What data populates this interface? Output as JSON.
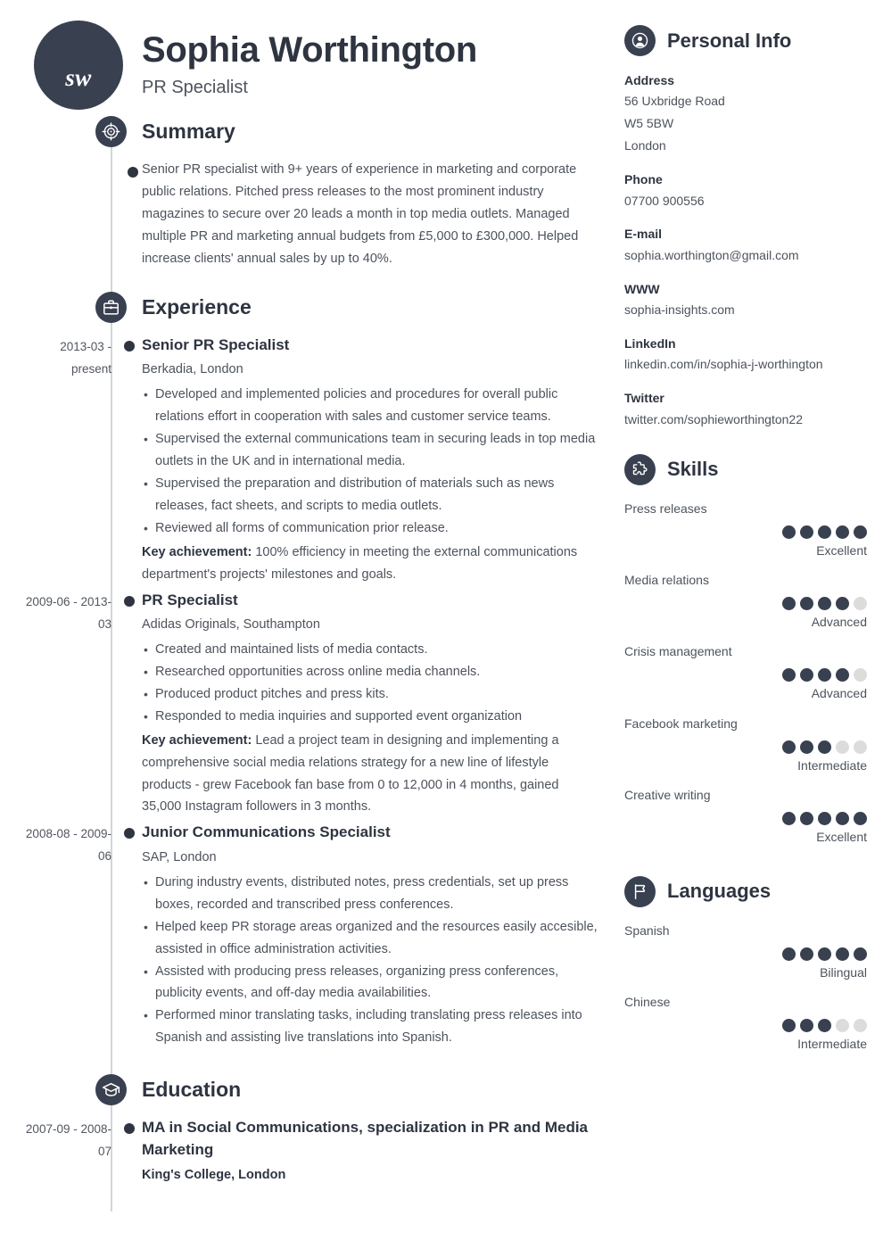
{
  "theme": {
    "dark": "#394050",
    "text": "#4d535c",
    "heading": "#2e3440",
    "dot_off": "#dcdcdc",
    "spine": "#d3d5d8"
  },
  "header": {
    "initials": "sw",
    "name": "Sophia Worthington",
    "job_title": "PR Specialist"
  },
  "summary": {
    "title": "Summary",
    "text": "Senior PR specialist with 9+ years of experience in marketing and corporate public relations. Pitched press releases to the most prominent industry magazines to secure over 20 leads a month in top media outlets. Managed multiple PR and marketing annual budgets from £5,000 to £300,000. Helped increase clients' annual sales by up to 40%."
  },
  "experience": {
    "title": "Experience",
    "entries": [
      {
        "date": "2013-03 - present",
        "role": "Senior PR Specialist",
        "company": "Berkadia, London",
        "bullets": [
          "Developed and implemented policies and procedures for overall public relations effort in cooperation with sales and customer service teams.",
          "Supervised the external communications team in securing leads in top media outlets in the UK and in international media.",
          "Supervised the preparation and distribution of materials such as news releases, fact sheets, and scripts to media outlets.",
          "Reviewed all forms of communication prior release."
        ],
        "achievement_label": "Key achievement:",
        "achievement_text": "100% efficiency in meeting the external communications department's projects' milestones and goals."
      },
      {
        "date": "2009-06 - 2013-03",
        "role": "PR Specialist",
        "company": "Adidas Originals, Southampton",
        "bullets": [
          "Created and maintained lists of media contacts.",
          "Researched opportunities across online media channels.",
          "Produced product pitches and press kits.",
          "Responded to media inquiries and supported event organization"
        ],
        "achievement_label": "Key achievement:",
        "achievement_text": "Lead a project team in designing and implementing a comprehensive social media relations strategy for a new line of lifestyle products - grew Facebook fan base from 0 to 12,000 in 4 months, gained 35,000 Instagram followers in 3 months."
      },
      {
        "date": "2008-08 - 2009-06",
        "role": "Junior Communications Specialist",
        "company": "SAP, London",
        "bullets": [
          "During industry events, distributed notes, press credentials, set up press boxes, recorded and transcribed press conferences.",
          "Helped keep PR storage areas organized and the resources easily accesible, assisted in office administration activities.",
          "Assisted with producing press releases, organizing press conferences, publicity events, and off-day media availabilities.",
          "Performed minor translating tasks, including translating press releases into Spanish and assisting live translations into Spanish."
        ],
        "achievement_label": "",
        "achievement_text": ""
      }
    ]
  },
  "education": {
    "title": "Education",
    "entries": [
      {
        "date": "2007-09 - 2008-07",
        "degree": "MA in Social Communications, specialization in PR and Media Marketing",
        "school": "King's College, London"
      }
    ]
  },
  "personal_info": {
    "title": "Personal Info",
    "fields": [
      {
        "label": "Address",
        "values": [
          "56 Uxbridge Road",
          "W5 5BW",
          "London"
        ]
      },
      {
        "label": "Phone",
        "values": [
          "07700 900556"
        ]
      },
      {
        "label": "E-mail",
        "values": [
          "sophia.worthington@gmail.com"
        ]
      },
      {
        "label": "WWW",
        "values": [
          "sophia-insights.com"
        ]
      },
      {
        "label": "LinkedIn",
        "values": [
          "linkedin.com/in/sophia-j-worthington"
        ]
      },
      {
        "label": "Twitter",
        "values": [
          "twitter.com/sophieworthington22"
        ]
      }
    ]
  },
  "skills": {
    "title": "Skills",
    "max": 5,
    "items": [
      {
        "name": "Press releases",
        "value": 5,
        "level": "Excellent"
      },
      {
        "name": "Media relations",
        "value": 4,
        "level": "Advanced"
      },
      {
        "name": "Crisis management",
        "value": 4,
        "level": "Advanced"
      },
      {
        "name": "Facebook marketing",
        "value": 3,
        "level": "Intermediate"
      },
      {
        "name": "Creative writing",
        "value": 5,
        "level": "Excellent"
      }
    ]
  },
  "languages": {
    "title": "Languages",
    "max": 5,
    "items": [
      {
        "name": "Spanish",
        "value": 5,
        "level": "Bilingual"
      },
      {
        "name": "Chinese",
        "value": 3,
        "level": "Intermediate"
      }
    ]
  },
  "icons": {
    "summary": "target-icon",
    "experience": "briefcase-icon",
    "education": "graduation-cap-icon",
    "personal_info": "person-icon",
    "skills": "puzzle-piece-icon",
    "languages": "flag-icon"
  }
}
